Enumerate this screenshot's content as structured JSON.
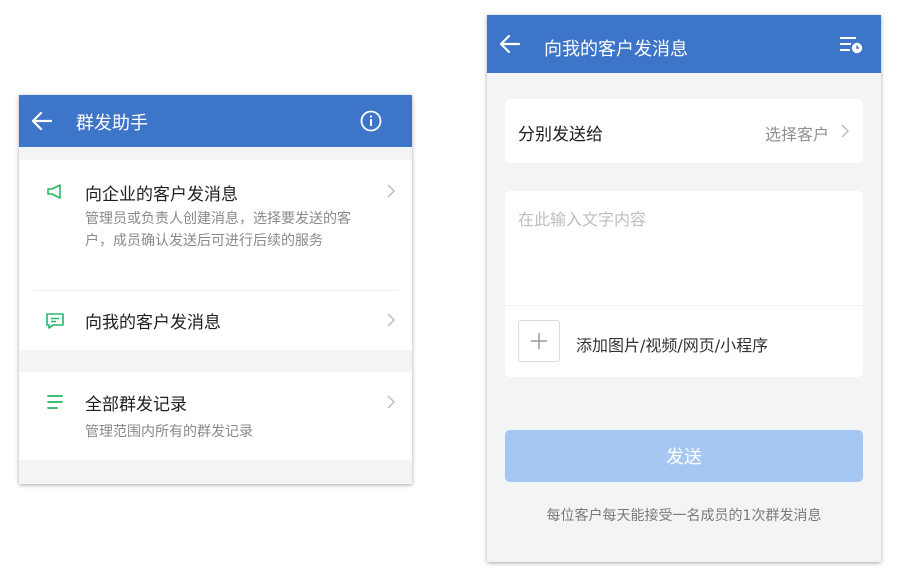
{
  "left": {
    "title": "群发助手",
    "items": [
      {
        "title": "向企业的客户发消息",
        "desc": "管理员或负责人创建消息，选择要发送的客户，成员确认发送后可进行后续的服务",
        "icon": "megaphone-icon"
      },
      {
        "title": "向我的客户发消息",
        "desc": "",
        "icon": "message-icon"
      },
      {
        "title": "全部群发记录",
        "desc": "管理范围内所有的群发记录",
        "icon": "list-icon"
      }
    ]
  },
  "right": {
    "title": "向我的客户发消息",
    "send_to_label": "分别发送给",
    "send_to_value": "选择客户",
    "placeholder": "在此输入文字内容",
    "attach_label": "添加图片/视频/网页/小程序",
    "send_button": "发送",
    "note": "每位客户每天能接受一名成员的1次群发消息"
  },
  "colors": {
    "header": "#3d75c9",
    "accent_green": "#25b864",
    "send_disabled": "#a6c7f1"
  }
}
